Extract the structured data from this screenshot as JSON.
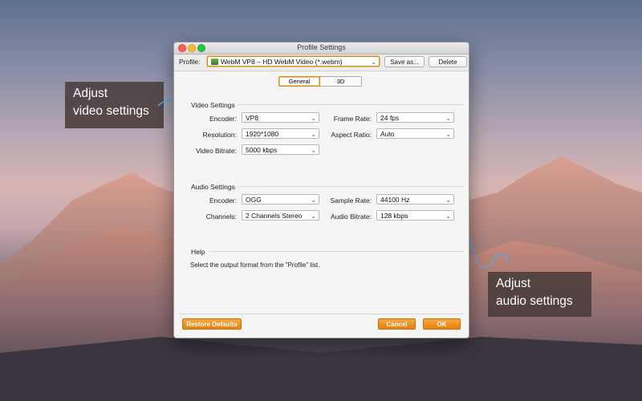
{
  "window": {
    "title": "Profile Settings"
  },
  "profile": {
    "label": "Profile:",
    "value": "WebM VP8 – HD WebM Video (*.webm)",
    "save_as": "Save as...",
    "delete": "Delete"
  },
  "tabs": [
    {
      "label": "General",
      "active": true
    },
    {
      "label": "3D",
      "active": false
    }
  ],
  "video": {
    "title": "Video Settings",
    "encoder_label": "Encoder:",
    "encoder_value": "VP8",
    "resolution_label": "Resolution:",
    "resolution_value": "1920*1080",
    "bitrate_label": "Video Bitrate:",
    "bitrate_value": "5000 kbps",
    "framerate_label": "Frame Rate:",
    "framerate_value": "24 fps",
    "aspect_label": "Aspect Ratio:",
    "aspect_value": "Auto"
  },
  "audio": {
    "title": "Audio Settings",
    "encoder_label": "Encoder:",
    "encoder_value": "OGG",
    "channels_label": "Channels:",
    "channels_value": "2 Channels Stereo",
    "samplerate_label": "Sample Rate:",
    "samplerate_value": "44100 Hz",
    "bitrate_label": "Audio Bitrate:",
    "bitrate_value": "128 kbps"
  },
  "help": {
    "title": "Help",
    "text": "Select the output format from the \"Profile\" list."
  },
  "footer": {
    "restore": "Restore Defaults",
    "cancel": "Cancel",
    "ok": "OK"
  },
  "callouts": {
    "video": [
      "Adjust",
      "video settings"
    ],
    "audio": [
      "Adjust",
      "audio settings"
    ]
  },
  "colors": {
    "accent": "#e8861a",
    "arrow": "#5aa8e6",
    "callout_bg": "#463a38"
  }
}
